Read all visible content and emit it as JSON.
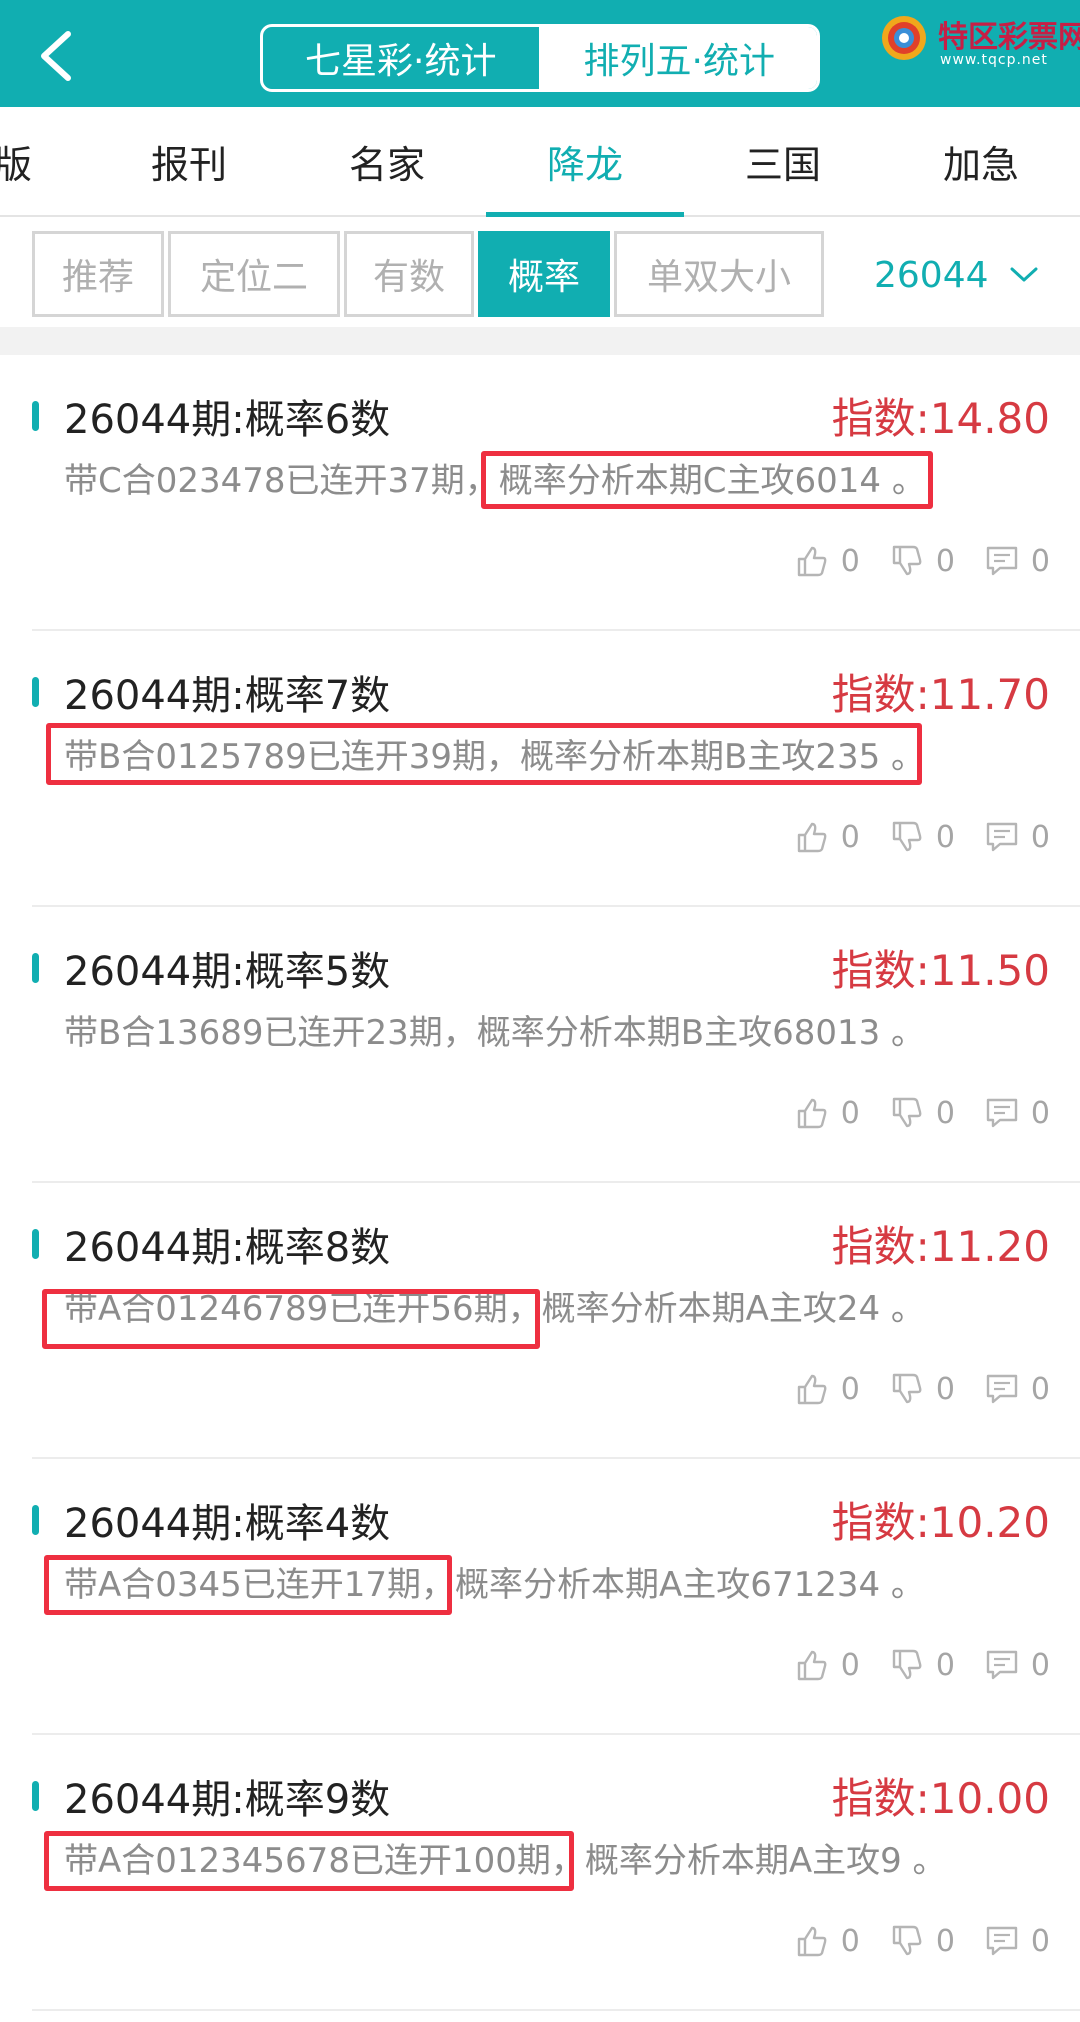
{
  "header": {
    "segments": [
      "七星彩·统计",
      "排列五·统计"
    ],
    "active_segment": 1,
    "logo": {
      "name": "特区彩票网",
      "url": "www.tqcp.net"
    }
  },
  "category_tabs": [
    "版",
    "报刊",
    "名家",
    "降龙",
    "三国",
    "加急"
  ],
  "active_category": "降龙",
  "filters": [
    "推荐",
    "定位二",
    "有数",
    "概率",
    "单双大小"
  ],
  "active_filter": "概率",
  "period": "26044",
  "cards": [
    {
      "title": "26044期:概率6数",
      "index": "指数:14.80",
      "desc": "带C合023478已连开37期，概率分析本期C主攻6014 。",
      "likes": "0",
      "dislikes": "0",
      "comments": "0"
    },
    {
      "title": "26044期:概率7数",
      "index": "指数:11.70",
      "desc": "带B合0125789已连开39期，概率分析本期B主攻235 。",
      "likes": "0",
      "dislikes": "0",
      "comments": "0"
    },
    {
      "title": "26044期:概率5数",
      "index": "指数:11.50",
      "desc": "带B合13689已连开23期，概率分析本期B主攻68013 。",
      "likes": "0",
      "dislikes": "0",
      "comments": "0"
    },
    {
      "title": "26044期:概率8数",
      "index": "指数:11.20",
      "desc": "带A合01246789已连开56期，概率分析本期A主攻24 。",
      "likes": "0",
      "dislikes": "0",
      "comments": "0"
    },
    {
      "title": "26044期:概率4数",
      "index": "指数:10.20",
      "desc": "带A合0345已连开17期，概率分析本期A主攻671234 。",
      "likes": "0",
      "dislikes": "0",
      "comments": "0"
    },
    {
      "title": "26044期:概率9数",
      "index": "指数:10.00",
      "desc": "带A合012345678已连开100期，概率分析本期A主攻9 。",
      "likes": "0",
      "dislikes": "0",
      "comments": "0"
    }
  ],
  "colors": {
    "accent": "#11aeb1",
    "index_red": "#d63a42",
    "highlight_red": "#ee2f40"
  }
}
